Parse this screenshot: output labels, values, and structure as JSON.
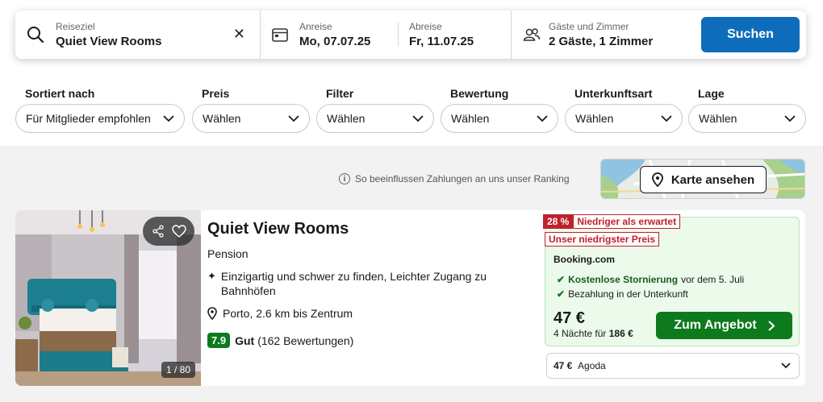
{
  "search": {
    "destination_label": "Reiseziel",
    "destination_value": "Quiet View Rooms",
    "checkin_label": "Anreise",
    "checkin_value": "Mo, 07.07.25",
    "checkout_label": "Abreise",
    "checkout_value": "Fr, 11.07.25",
    "guests_label": "Gäste und Zimmer",
    "guests_value": "2 Gäste, 1 Zimmer",
    "search_button": "Suchen"
  },
  "filters": [
    {
      "label": "Sortiert nach",
      "value": "Für Mitglieder empfohlen"
    },
    {
      "label": "Preis",
      "value": "Wählen"
    },
    {
      "label": "Filter",
      "value": "Wählen"
    },
    {
      "label": "Bewertung",
      "value": "Wählen"
    },
    {
      "label": "Unterkunftsart",
      "value": "Wählen"
    },
    {
      "label": "Lage",
      "value": "Wählen"
    }
  ],
  "ranking_note": "So beeinflussen Zahlungen an uns unser Ranking",
  "map_button": "Karte ansehen",
  "hotel": {
    "photo_counter": "1 / 80",
    "name": "Quiet View Rooms",
    "type": "Pension",
    "feature": "Einzigartig und schwer zu finden, Leichter Zugang zu Bahnhöfen",
    "location": "Porto, 2.6 km bis Zentrum",
    "score": "7.9",
    "score_word": "Gut",
    "reviews": "(162 Bewertungen)"
  },
  "deal": {
    "discount_pct": "28 %",
    "discount_text": "Niedriger als erwartet",
    "lowest_badge": "Unser niedrigster Preis",
    "provider": "Booking.com",
    "perk1_bold": "Kostenlose Stornierung",
    "perk1_rest": "vor dem 5. Juli",
    "perk2": "Bezahlung in der Unterkunft",
    "price": "47 €",
    "nights_text": "4 Nächte für",
    "nights_total": "186 €",
    "cta": "Zum Angebot",
    "alt_price": "47 €",
    "alt_provider": "Agoda"
  },
  "colors": {
    "search_button": "#0d6dba",
    "deal_button": "#0c7a1d",
    "deal_bg": "#ebfaea",
    "badge_red": "#c0202c"
  }
}
